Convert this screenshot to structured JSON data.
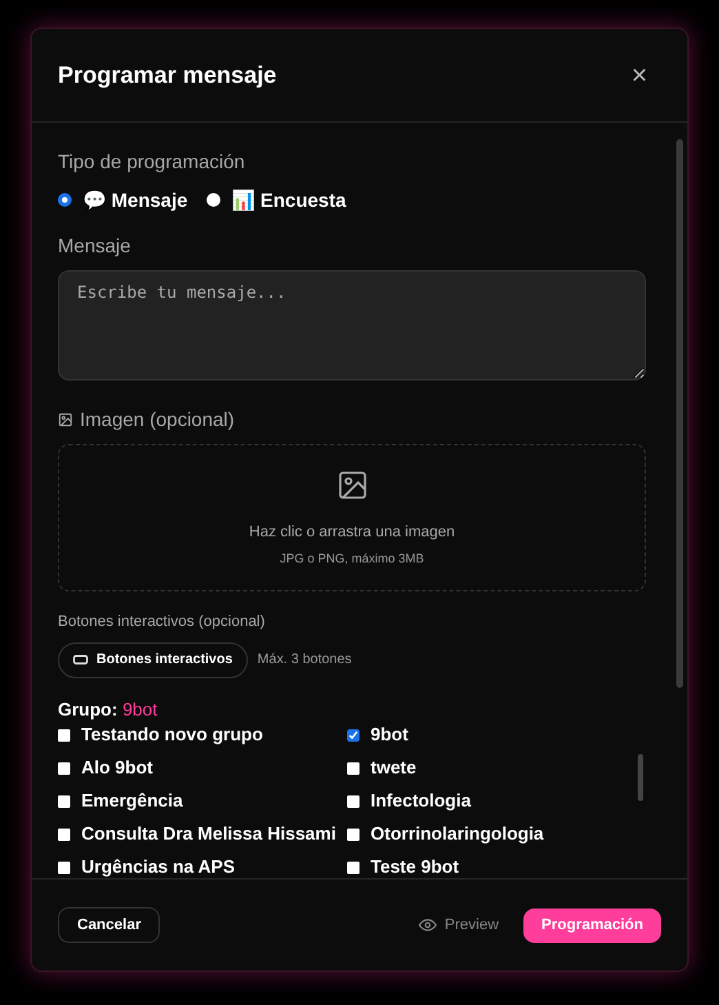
{
  "dialog": {
    "title": "Programar mensaje",
    "close_label": "×"
  },
  "schedule_type": {
    "label": "Tipo de programación",
    "options": [
      {
        "label": "💬 Mensaje",
        "selected": true
      },
      {
        "label": "📊 Encuesta",
        "selected": false
      }
    ]
  },
  "message": {
    "label": "Mensaje",
    "placeholder": "Escribe tu mensaje..."
  },
  "image": {
    "label": "Imagen (opcional)",
    "drop_text": "Haz clic o arrastra una imagen",
    "hint": "JPG o PNG, máximo 3MB"
  },
  "interactive_buttons": {
    "label": "Botones interactivos (opcional)",
    "button": "Botones interactivos",
    "limit": "Máx. 3 botones"
  },
  "group": {
    "label": "Grupo:",
    "value": "9bot",
    "items": [
      {
        "label": "Testando novo grupo",
        "checked": false
      },
      {
        "label": "9bot",
        "checked": true
      },
      {
        "label": "Alo 9bot",
        "checked": false
      },
      {
        "label": "twete",
        "checked": false
      },
      {
        "label": "Emergência",
        "checked": false
      },
      {
        "label": "Infectologia",
        "checked": false
      },
      {
        "label": "Consulta Dra Melissa Hissami",
        "checked": false
      },
      {
        "label": "Otorrinolaringologia",
        "checked": false
      },
      {
        "label": "Urgências na APS",
        "checked": false
      },
      {
        "label": "Teste 9bot",
        "checked": false
      }
    ]
  },
  "footer": {
    "cancel": "Cancelar",
    "preview": "Preview",
    "submit": "Programación"
  }
}
